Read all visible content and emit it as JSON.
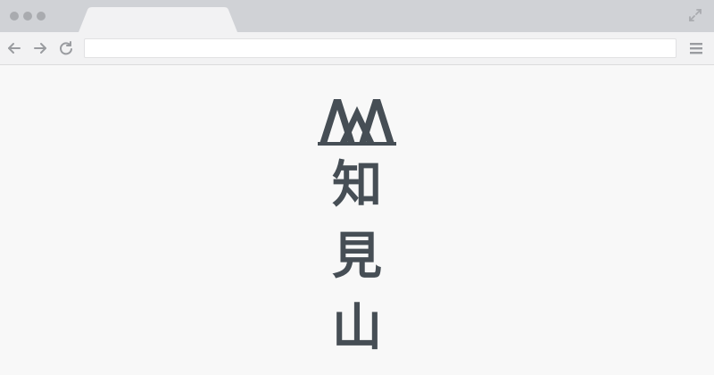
{
  "browser": {
    "window_dots": [
      "close",
      "minimize",
      "zoom"
    ],
    "tab": {
      "title": ""
    },
    "toolbar": {
      "back_icon": "arrow-left-icon",
      "forward_icon": "arrow-right-icon",
      "reload_icon": "reload-icon",
      "address_value": "",
      "menu_icon": "hamburger-menu-icon",
      "expand_icon": "expand-icon"
    }
  },
  "page": {
    "logo": {
      "icon": "mountain-logo-icon",
      "color": "#464e55"
    },
    "brand_chars": [
      "知",
      "見",
      "山"
    ]
  },
  "colors": {
    "titlebar": "#d0d2d6",
    "toolbar": "#f2f2f3",
    "page_background": "#f8f8f8",
    "brand_ink": "#464e55",
    "icon_gray": "#9a9ca0"
  }
}
